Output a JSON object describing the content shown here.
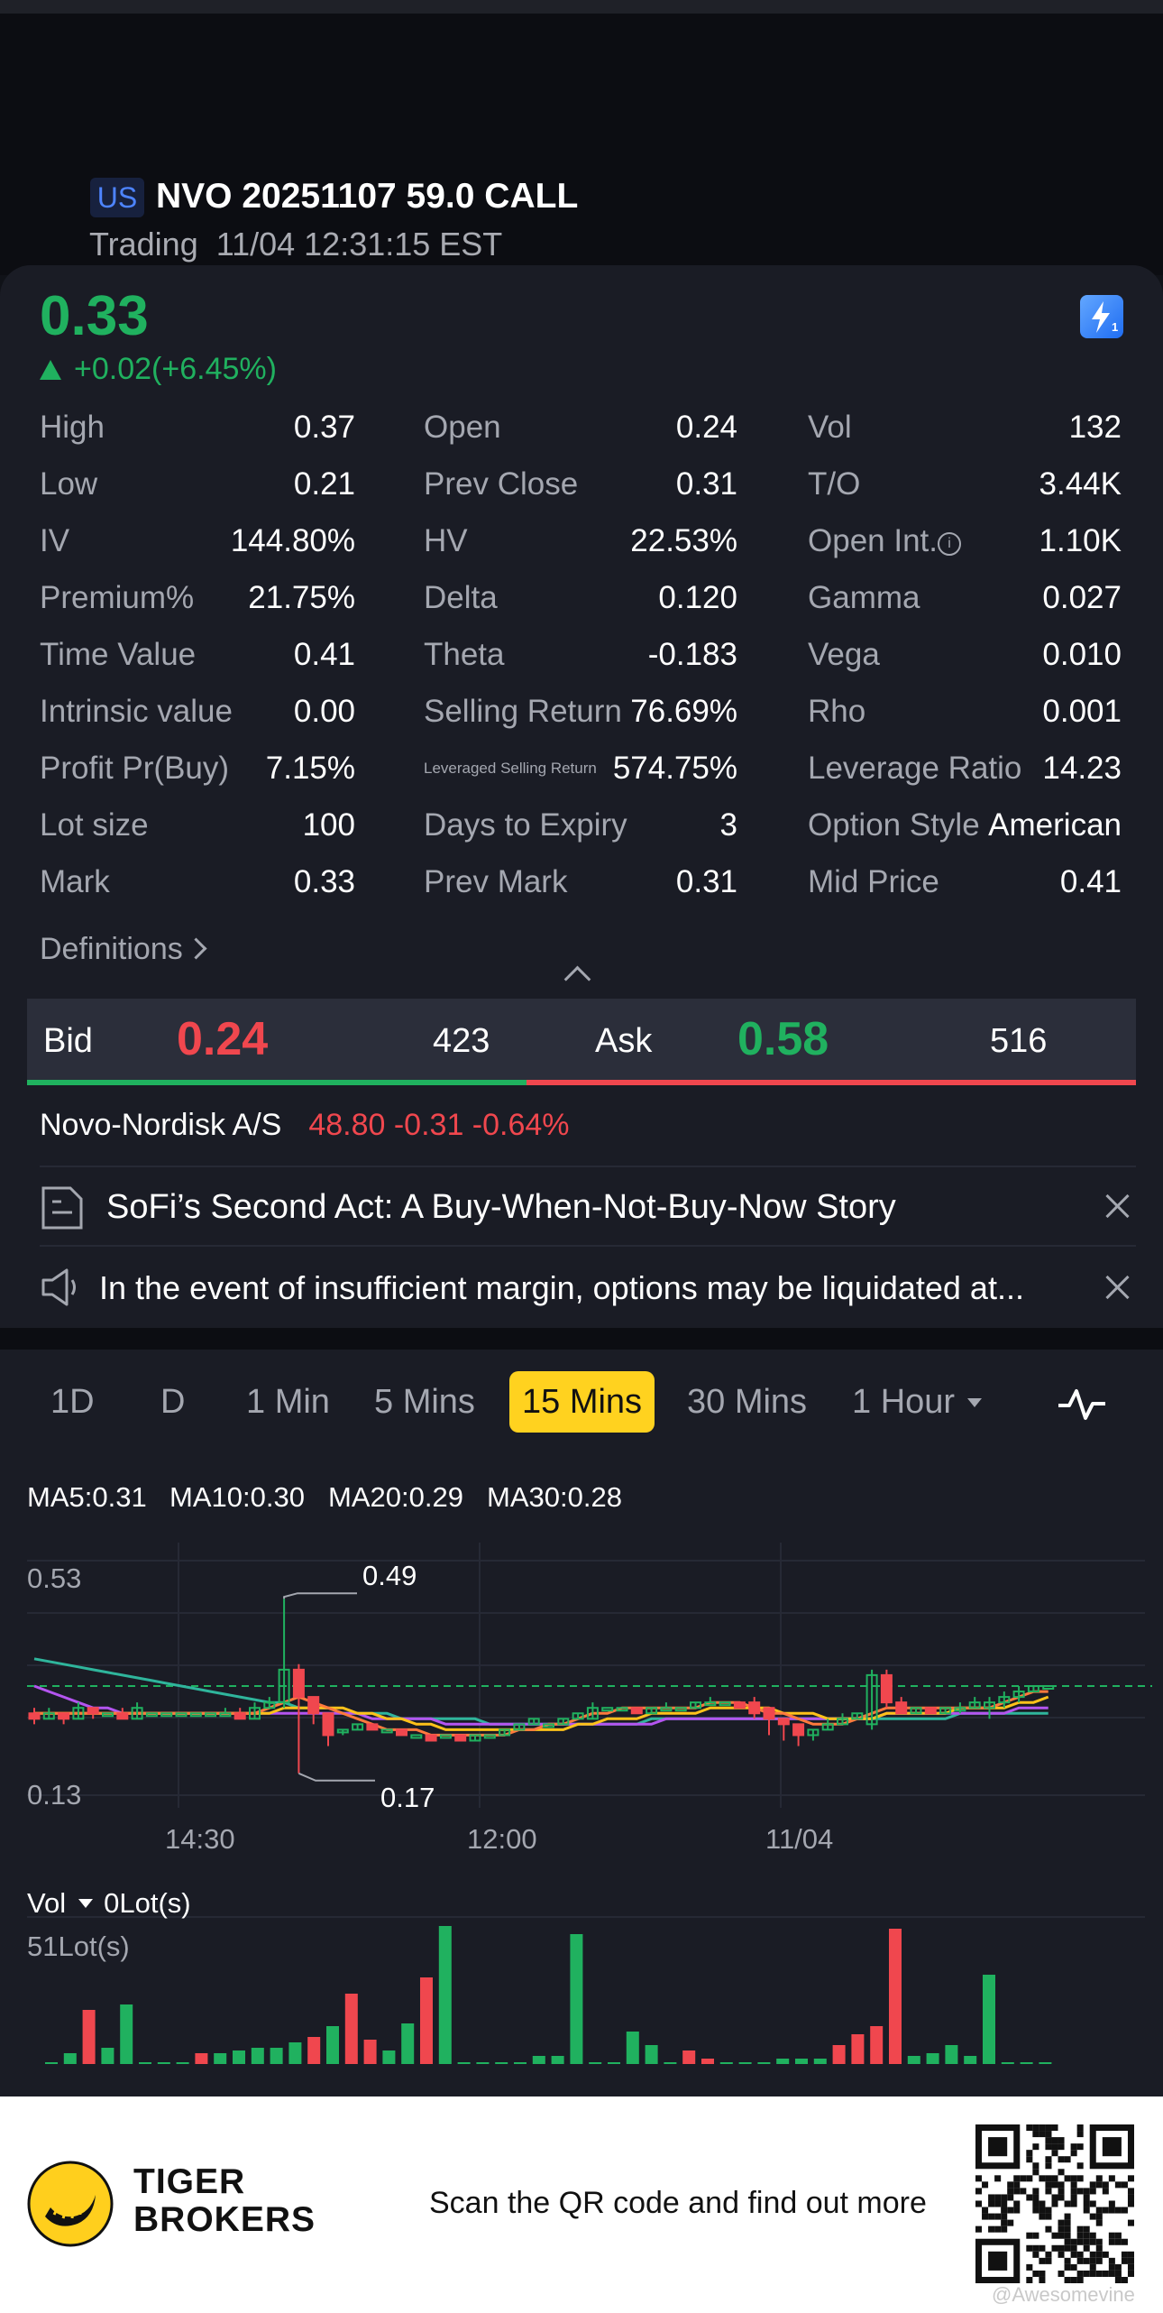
{
  "header": {
    "market": "US",
    "symbol": "NVO 20251107 59.0 CALL",
    "status_line": "Trading  11/04 12:31:15 EST"
  },
  "quote": {
    "price": "0.33",
    "change": "+0.02(+6.45%)",
    "colors": {
      "up": "#20b15f",
      "down": "#f0474e",
      "accent": "#ffd21f"
    }
  },
  "stats": {
    "col1": [
      {
        "label": "High",
        "value": "0.37"
      },
      {
        "label": "Low",
        "value": "0.21"
      },
      {
        "label": "IV",
        "value": "144.80%"
      },
      {
        "label": "Premium%",
        "value": "21.75%"
      },
      {
        "label": "Time Value",
        "value": "0.41"
      },
      {
        "label": "Intrinsic value",
        "value": "0.00"
      },
      {
        "label": "Profit Pr(Buy)",
        "value": "7.15%"
      },
      {
        "label": "Lot size",
        "value": "100"
      },
      {
        "label": "Mark",
        "value": "0.33"
      }
    ],
    "col2": [
      {
        "label": "Open",
        "value": "0.24"
      },
      {
        "label": "Prev Close",
        "value": "0.31"
      },
      {
        "label": "HV",
        "value": "22.53%"
      },
      {
        "label": "Delta",
        "value": "0.120"
      },
      {
        "label": "Theta",
        "value": "-0.183"
      },
      {
        "label": "Selling Return",
        "value": "76.69%"
      },
      {
        "label": "Leveraged Selling Return",
        "value": "574.75%"
      },
      {
        "label": "Days to Expiry",
        "value": "3"
      },
      {
        "label": "Prev Mark",
        "value": "0.31"
      }
    ],
    "col3": [
      {
        "label": "Vol",
        "value": "132"
      },
      {
        "label": "T/O",
        "value": "3.44K"
      },
      {
        "label": "Open Int.",
        "value": "1.10K"
      },
      {
        "label": "Gamma",
        "value": "0.027"
      },
      {
        "label": "Vega",
        "value": "0.010"
      },
      {
        "label": "Rho",
        "value": "0.001"
      },
      {
        "label": "Leverage Ratio",
        "value": "14.23"
      },
      {
        "label": "Option Style",
        "value": "American"
      },
      {
        "label": "Mid Price",
        "value": "0.41"
      }
    ],
    "definitions_label": "Definitions"
  },
  "bid_ask": {
    "bid_label": "Bid",
    "bid": "0.24",
    "bid_size": "423",
    "ask_label": "Ask",
    "ask": "0.58",
    "ask_size": "516",
    "bid_share": 0.45
  },
  "underlying": {
    "name": "Novo-Nordisk A/S",
    "quote": "48.80 -0.31 -0.64%"
  },
  "news": {
    "headline": "SoFi’s Second Act: A Buy-When-Not-Buy-Now Story",
    "notice": "In the event of insufficient margin, options may be liquidated at..."
  },
  "chart_tabs": {
    "tabs": [
      "1D",
      "D",
      "1 Min",
      "5 Mins",
      "15 Mins",
      "30 Mins",
      "1 Hour"
    ],
    "active": "15 Mins"
  },
  "ma_legend": [
    {
      "label": "MA5:0.31",
      "color": "#ff7a3d"
    },
    {
      "label": "MA10:0.30",
      "color": "#ffc21a"
    },
    {
      "label": "MA20:0.29",
      "color": "#b455f0"
    },
    {
      "label": "MA30:0.28",
      "color": "#2fb59c"
    }
  ],
  "chart_data": {
    "type": "candlestick",
    "y_ticks": [
      "0.53",
      "0.13"
    ],
    "ylim": [
      0.13,
      0.53
    ],
    "x_ticks": [
      "14:30",
      "12:00",
      "11/04"
    ],
    "annotations": [
      {
        "label": "0.49",
        "value": 0.49
      },
      {
        "label": "0.17",
        "value": 0.17
      }
    ],
    "last_price_line": 0.33,
    "candles": [
      [
        0.28,
        0.27,
        0.29,
        0.26
      ],
      [
        0.27,
        0.28,
        0.29,
        0.27
      ],
      [
        0.28,
        0.27,
        0.28,
        0.26
      ],
      [
        0.27,
        0.29,
        0.3,
        0.27
      ],
      [
        0.29,
        0.28,
        0.29,
        0.27
      ],
      [
        0.28,
        0.28,
        0.28,
        0.28
      ],
      [
        0.28,
        0.27,
        0.29,
        0.27
      ],
      [
        0.27,
        0.29,
        0.3,
        0.27
      ],
      [
        0.28,
        0.28,
        0.28,
        0.28
      ],
      [
        0.28,
        0.28,
        0.28,
        0.28
      ],
      [
        0.28,
        0.28,
        0.28,
        0.28
      ],
      [
        0.28,
        0.28,
        0.28,
        0.28
      ],
      [
        0.28,
        0.28,
        0.28,
        0.28
      ],
      [
        0.28,
        0.28,
        0.29,
        0.28
      ],
      [
        0.28,
        0.27,
        0.29,
        0.27
      ],
      [
        0.27,
        0.29,
        0.3,
        0.27
      ],
      [
        0.29,
        0.3,
        0.31,
        0.29
      ],
      [
        0.3,
        0.36,
        0.49,
        0.29
      ],
      [
        0.36,
        0.31,
        0.37,
        0.17
      ],
      [
        0.31,
        0.28,
        0.31,
        0.26
      ],
      [
        0.28,
        0.24,
        0.28,
        0.22
      ],
      [
        0.25,
        0.25,
        0.25,
        0.24
      ],
      [
        0.25,
        0.26,
        0.26,
        0.25
      ],
      [
        0.26,
        0.25,
        0.26,
        0.25
      ],
      [
        0.25,
        0.25,
        0.25,
        0.25
      ],
      [
        0.25,
        0.24,
        0.25,
        0.24
      ],
      [
        0.24,
        0.24,
        0.24,
        0.24
      ],
      [
        0.24,
        0.23,
        0.24,
        0.23
      ],
      [
        0.24,
        0.24,
        0.24,
        0.24
      ],
      [
        0.24,
        0.23,
        0.24,
        0.23
      ],
      [
        0.23,
        0.24,
        0.24,
        0.23
      ],
      [
        0.24,
        0.24,
        0.24,
        0.24
      ],
      [
        0.24,
        0.25,
        0.25,
        0.24
      ],
      [
        0.25,
        0.26,
        0.26,
        0.25
      ],
      [
        0.26,
        0.27,
        0.27,
        0.26
      ],
      [
        0.26,
        0.26,
        0.26,
        0.26
      ],
      [
        0.26,
        0.27,
        0.27,
        0.26
      ],
      [
        0.27,
        0.28,
        0.28,
        0.27
      ],
      [
        0.27,
        0.29,
        0.3,
        0.27
      ],
      [
        0.29,
        0.29,
        0.29,
        0.29
      ],
      [
        0.29,
        0.29,
        0.29,
        0.29
      ],
      [
        0.29,
        0.28,
        0.29,
        0.28
      ],
      [
        0.28,
        0.29,
        0.29,
        0.28
      ],
      [
        0.29,
        0.29,
        0.3,
        0.29
      ],
      [
        0.29,
        0.29,
        0.29,
        0.29
      ],
      [
        0.29,
        0.3,
        0.3,
        0.29
      ],
      [
        0.3,
        0.3,
        0.31,
        0.3
      ],
      [
        0.3,
        0.3,
        0.3,
        0.3
      ],
      [
        0.3,
        0.29,
        0.3,
        0.29
      ],
      [
        0.3,
        0.28,
        0.31,
        0.27
      ],
      [
        0.29,
        0.27,
        0.29,
        0.24
      ],
      [
        0.27,
        0.26,
        0.27,
        0.23
      ],
      [
        0.26,
        0.24,
        0.26,
        0.22
      ],
      [
        0.24,
        0.25,
        0.25,
        0.23
      ],
      [
        0.25,
        0.26,
        0.27,
        0.25
      ],
      [
        0.26,
        0.27,
        0.28,
        0.26
      ],
      [
        0.27,
        0.28,
        0.28,
        0.27
      ],
      [
        0.26,
        0.35,
        0.36,
        0.25
      ],
      [
        0.35,
        0.3,
        0.36,
        0.29
      ],
      [
        0.3,
        0.28,
        0.31,
        0.28
      ],
      [
        0.28,
        0.29,
        0.29,
        0.28
      ],
      [
        0.29,
        0.28,
        0.29,
        0.28
      ],
      [
        0.28,
        0.29,
        0.29,
        0.28
      ],
      [
        0.29,
        0.29,
        0.3,
        0.28
      ],
      [
        0.29,
        0.3,
        0.31,
        0.29
      ],
      [
        0.29,
        0.3,
        0.31,
        0.27
      ],
      [
        0.3,
        0.31,
        0.32,
        0.29
      ],
      [
        0.31,
        0.32,
        0.33,
        0.3
      ],
      [
        0.32,
        0.33,
        0.33,
        0.32
      ],
      [
        0.33,
        0.33,
        0.33,
        0.33
      ]
    ],
    "candle_fields": [
      "open",
      "close",
      "high",
      "low"
    ],
    "ma5": [
      0.28,
      0.28,
      0.28,
      0.28,
      0.28,
      0.28,
      0.28,
      0.28,
      0.28,
      0.28,
      0.28,
      0.28,
      0.28,
      0.28,
      0.28,
      0.28,
      0.29,
      0.3,
      0.31,
      0.3,
      0.29,
      0.28,
      0.27,
      0.26,
      0.25,
      0.25,
      0.25,
      0.24,
      0.24,
      0.24,
      0.24,
      0.24,
      0.24,
      0.25,
      0.25,
      0.26,
      0.26,
      0.27,
      0.28,
      0.28,
      0.29,
      0.29,
      0.29,
      0.29,
      0.29,
      0.29,
      0.3,
      0.3,
      0.3,
      0.29,
      0.28,
      0.28,
      0.27,
      0.26,
      0.26,
      0.26,
      0.27,
      0.28,
      0.29,
      0.29,
      0.29,
      0.29,
      0.29,
      0.29,
      0.29,
      0.29,
      0.3,
      0.31,
      0.32,
      0.32
    ],
    "ma10": [
      0.28,
      0.28,
      0.28,
      0.28,
      0.28,
      0.28,
      0.28,
      0.28,
      0.28,
      0.28,
      0.28,
      0.28,
      0.28,
      0.28,
      0.28,
      0.28,
      0.28,
      0.29,
      0.29,
      0.29,
      0.29,
      0.29,
      0.28,
      0.28,
      0.27,
      0.27,
      0.26,
      0.26,
      0.25,
      0.25,
      0.25,
      0.25,
      0.25,
      0.25,
      0.25,
      0.25,
      0.25,
      0.26,
      0.26,
      0.27,
      0.27,
      0.27,
      0.28,
      0.28,
      0.28,
      0.28,
      0.29,
      0.29,
      0.29,
      0.29,
      0.29,
      0.28,
      0.28,
      0.28,
      0.27,
      0.27,
      0.27,
      0.27,
      0.28,
      0.28,
      0.28,
      0.28,
      0.28,
      0.29,
      0.29,
      0.29,
      0.29,
      0.3,
      0.3,
      0.31
    ],
    "ma20": [
      0.33,
      0.32,
      0.31,
      0.3,
      0.29,
      0.29,
      0.28,
      0.28,
      0.28,
      0.28,
      0.28,
      0.28,
      0.28,
      0.28,
      0.28,
      0.28,
      0.28,
      0.28,
      0.28,
      0.28,
      0.28,
      0.28,
      0.28,
      0.27,
      0.27,
      0.27,
      0.27,
      0.27,
      0.26,
      0.26,
      0.26,
      0.26,
      0.26,
      0.26,
      0.26,
      0.26,
      0.26,
      0.26,
      0.26,
      0.26,
      0.26,
      0.26,
      0.26,
      0.27,
      0.27,
      0.27,
      0.27,
      0.27,
      0.27,
      0.27,
      0.27,
      0.27,
      0.27,
      0.27,
      0.27,
      0.27,
      0.27,
      0.27,
      0.28,
      0.28,
      0.28,
      0.28,
      0.28,
      0.28,
      0.28,
      0.28,
      0.28,
      0.29,
      0.29,
      0.29
    ],
    "ma30": [
      0.38,
      0.375,
      0.37,
      0.365,
      0.36,
      0.355,
      0.35,
      0.345,
      0.34,
      0.335,
      0.33,
      0.325,
      0.32,
      0.315,
      0.31,
      0.305,
      0.3,
      0.3,
      0.29,
      0.29,
      0.29,
      0.28,
      0.28,
      0.28,
      0.28,
      0.27,
      0.27,
      0.27,
      0.27,
      0.27,
      0.27,
      0.26,
      0.26,
      0.26,
      0.26,
      0.26,
      0.26,
      0.26,
      0.26,
      0.26,
      0.26,
      0.26,
      0.27,
      0.27,
      0.27,
      0.27,
      0.27,
      0.27,
      0.27,
      0.27,
      0.27,
      0.27,
      0.27,
      0.27,
      0.27,
      0.27,
      0.27,
      0.27,
      0.27,
      0.27,
      0.27,
      0.27,
      0.27,
      0.28,
      0.28,
      0.28,
      0.28,
      0.28,
      0.28,
      0.28
    ]
  },
  "volume": {
    "label": "Vol",
    "current": "0Lot(s)",
    "max_label": "51Lot(s)",
    "max": 51,
    "bars": [
      [
        0,
        "g"
      ],
      [
        4,
        "g"
      ],
      [
        20,
        "r"
      ],
      [
        6,
        "g"
      ],
      [
        22,
        "g"
      ],
      [
        0,
        "g"
      ],
      [
        0,
        "g"
      ],
      [
        0,
        "g"
      ],
      [
        4,
        "r"
      ],
      [
        4,
        "g"
      ],
      [
        5,
        "g"
      ],
      [
        6,
        "g"
      ],
      [
        6,
        "g"
      ],
      [
        8,
        "g"
      ],
      [
        10,
        "r"
      ],
      [
        14,
        "g"
      ],
      [
        26,
        "r"
      ],
      [
        9,
        "r"
      ],
      [
        5,
        "g"
      ],
      [
        15,
        "g"
      ],
      [
        32,
        "r"
      ],
      [
        51,
        "g"
      ],
      [
        0,
        "g"
      ],
      [
        0,
        "g"
      ],
      [
        0,
        "g"
      ],
      [
        0,
        "g"
      ],
      [
        3,
        "g"
      ],
      [
        3,
        "g"
      ],
      [
        48,
        "g"
      ],
      [
        0,
        "g"
      ],
      [
        0,
        "g"
      ],
      [
        12,
        "g"
      ],
      [
        7,
        "g"
      ],
      [
        0,
        "g"
      ],
      [
        5,
        "r"
      ],
      [
        2,
        "r"
      ],
      [
        0,
        "g"
      ],
      [
        0,
        "g"
      ],
      [
        0,
        "g"
      ],
      [
        2,
        "g"
      ],
      [
        2,
        "g"
      ],
      [
        2,
        "g"
      ],
      [
        7,
        "r"
      ],
      [
        11,
        "r"
      ],
      [
        14,
        "r"
      ],
      [
        50,
        "r"
      ],
      [
        3,
        "g"
      ],
      [
        4,
        "g"
      ],
      [
        7,
        "g"
      ],
      [
        3,
        "g"
      ],
      [
        33,
        "g"
      ],
      [
        0,
        "g"
      ],
      [
        0,
        "g"
      ],
      [
        0,
        "g"
      ]
    ]
  },
  "footer": {
    "brand": "TIGER\nBROKERS",
    "cta": "Scan the QR code and find out more",
    "watermark": "@Awesomevine"
  }
}
